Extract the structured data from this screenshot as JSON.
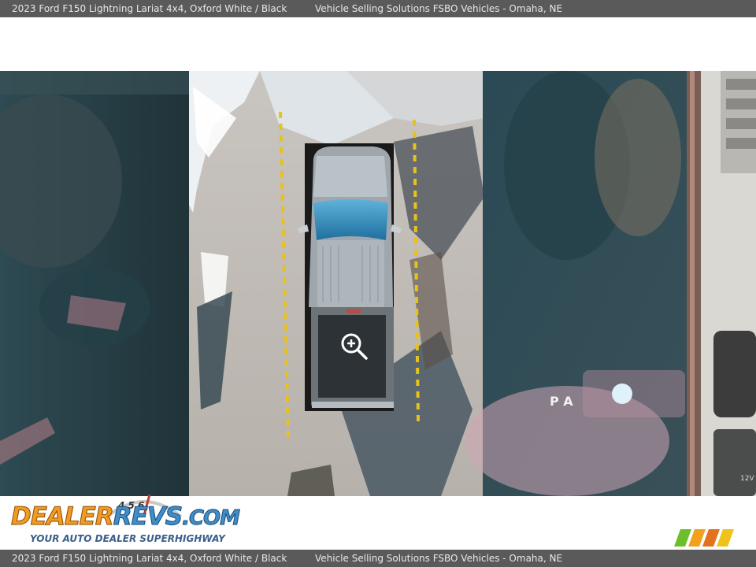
{
  "header": {
    "vehicle": "2023 Ford F150 Lightning Lariat 4x4,",
    "color": "Oxford White / Black",
    "dealer": "Vehicle Selling Solutions FSBO Vehicles - Omaha, NE"
  },
  "footer": {
    "vehicle": "2023 Ford F150 Lightning Lariat 4x4,",
    "color": "Oxford White / Black",
    "dealer": "Vehicle Selling Solutions FSBO Vehicles - Omaha, NE"
  },
  "photo": {
    "screen_label": "P A",
    "port_label": "12V",
    "zoom_icon": "zoom-in-icon"
  },
  "logo": {
    "dealer": "DEALER",
    "revs": "REVS",
    "com": ".COM",
    "tagline": "YOUR AUTO DEALER SUPERHIGHWAY",
    "gauge_digits": "4 5 6"
  },
  "colors": {
    "bar": "#5a5a5a",
    "dealer_orange": "#f39a22",
    "revs_blue": "#3d8ec9",
    "lane_yellow": "#e8c21c"
  }
}
